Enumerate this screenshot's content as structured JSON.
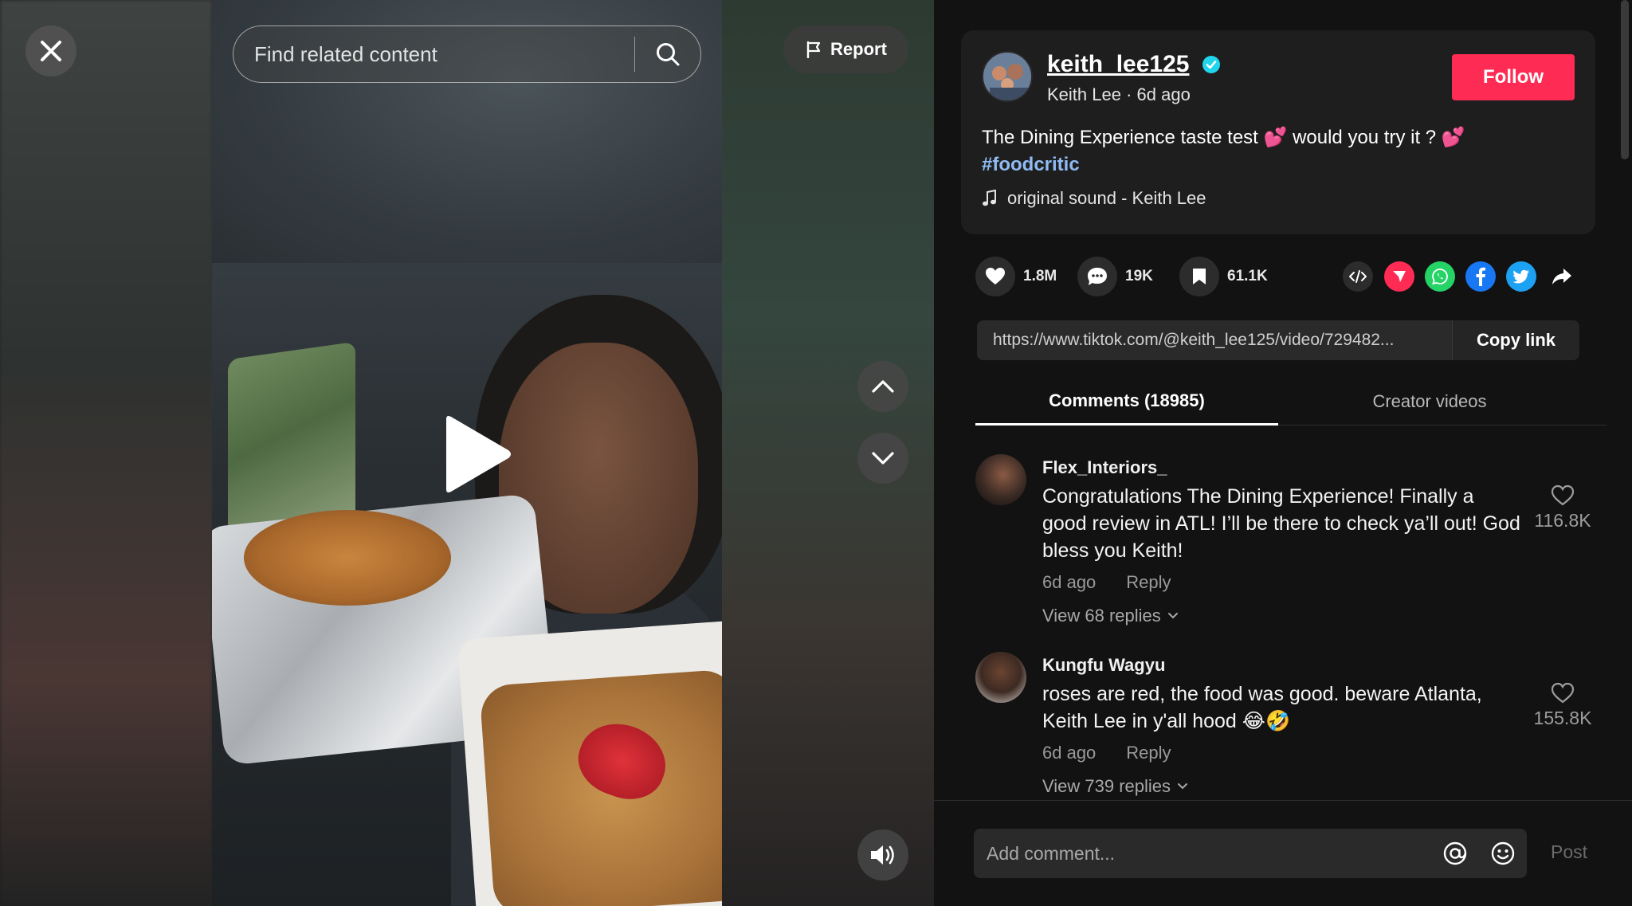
{
  "search": {
    "placeholder": "Find related content"
  },
  "report": {
    "label": "Report"
  },
  "post": {
    "username": "keith_lee125",
    "display_name": "Keith Lee",
    "age": "6d ago",
    "subline": "Keith Lee · 6d ago",
    "follow_label": "Follow",
    "caption_text": "The Dining Experience taste test 💕 would you try it ? 💕",
    "hashtag": "#foodcritic",
    "sound": "original sound - Keith Lee"
  },
  "stats": {
    "likes": "1.8M",
    "comments": "19K",
    "saves": "61.1K"
  },
  "share_icons": [
    "embed-code-icon",
    "send-to-friends-icon",
    "whatsapp-icon",
    "facebook-icon",
    "twitter-icon",
    "share-arrow-icon"
  ],
  "link": {
    "url": "https://www.tiktok.com/@keith_lee125/video/729482...",
    "copy_label": "Copy link"
  },
  "tabs": {
    "comments": "Comments (18985)",
    "creator": "Creator videos"
  },
  "comments": [
    {
      "name": "Flex_Interiors_",
      "text": "Congratulations The Dining Experience! Finally a good review in ATL! I’ll be there to check ya’ll out! God bless you Keith!",
      "time": "6d ago",
      "reply": "Reply",
      "replies": "View 68 replies",
      "likes": "116.8K"
    },
    {
      "name": "Kungfu Wagyu",
      "text": "roses are red, the food was good. beware Atlanta, Keith Lee in y'all hood 😂🤣",
      "time": "6d ago",
      "reply": "Reply",
      "replies": "View 739 replies",
      "likes": "155.8K"
    }
  ],
  "comment_box": {
    "placeholder": "Add comment...",
    "post_label": "Post"
  },
  "colors": {
    "follow": "#fe2c55",
    "hashtag": "#8fbbf3",
    "panel_bg": "#121212",
    "card_bg": "#1e1e1e"
  }
}
